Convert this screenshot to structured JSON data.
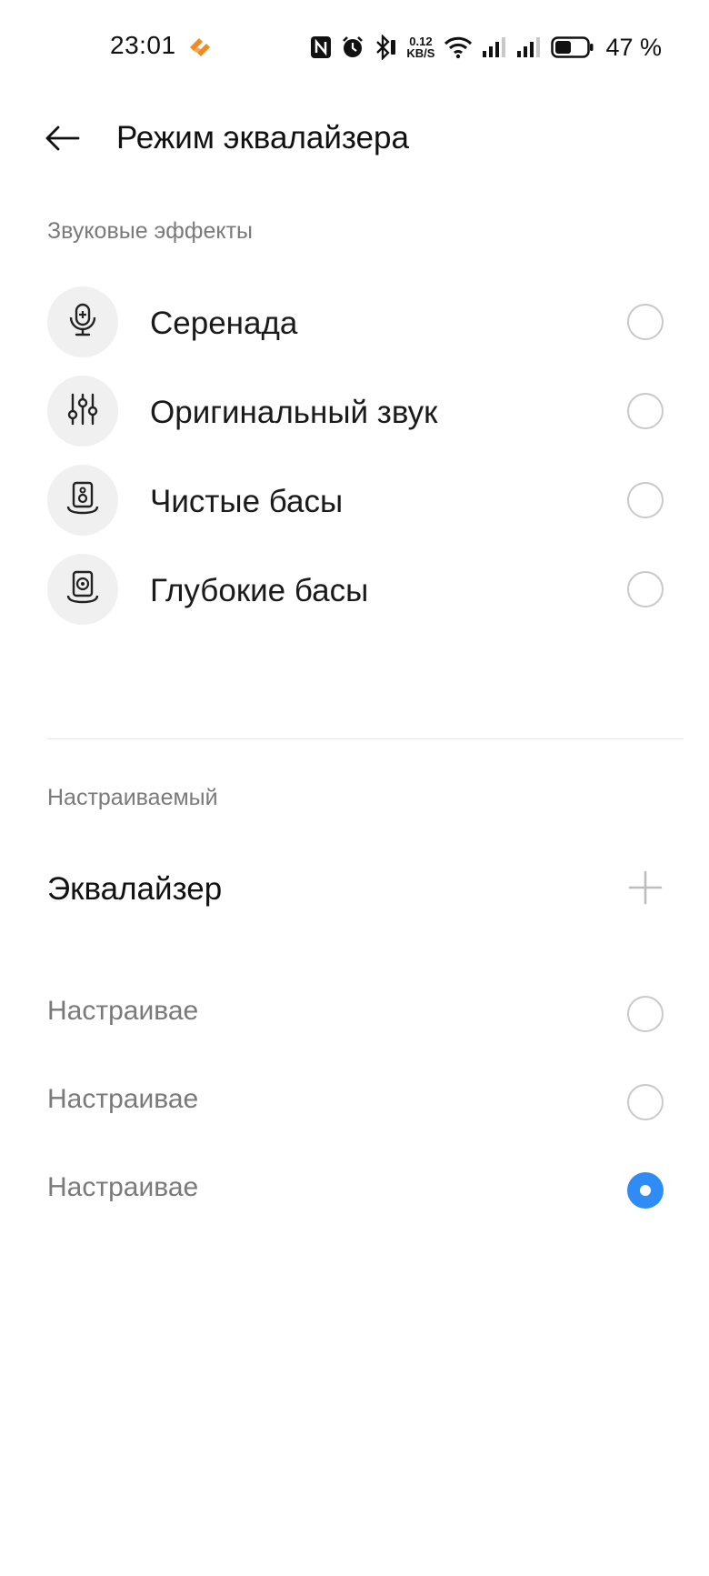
{
  "status_bar": {
    "time": "23:01",
    "net_speed_value": "0.12",
    "net_speed_unit": "KB/S",
    "battery_percent": "47 %",
    "icons": [
      "app-notification-icon",
      "nfc-icon",
      "alarm-icon",
      "bluetooth-icon",
      "wifi-icon",
      "signal-icon",
      "signal-icon",
      "battery-icon"
    ]
  },
  "header": {
    "title": "Режим эквалайзера"
  },
  "sound_effects": {
    "section_title": "Звуковые эффекты",
    "items": [
      {
        "label": "Серенада",
        "icon": "microphone-icon",
        "selected": false
      },
      {
        "label": "Оригинальный звук",
        "icon": "sliders-icon",
        "selected": false
      },
      {
        "label": "Чистые басы",
        "icon": "speaker-icon",
        "selected": false
      },
      {
        "label": "Глубокие басы",
        "icon": "speaker-bass-icon",
        "selected": false
      }
    ]
  },
  "custom": {
    "section_title": "Настраиваемый",
    "equalizer_label": "Эквалайзер",
    "add_icon": "plus-icon",
    "items": [
      {
        "label": "Настраивае",
        "selected": false
      },
      {
        "label": "Настраивае",
        "selected": false
      },
      {
        "label": "Настраивае",
        "selected": true
      }
    ]
  },
  "colors": {
    "accent": "#2f8cf5",
    "app_icon": "#f08a24",
    "secondary_text": "#7a7a7a"
  }
}
